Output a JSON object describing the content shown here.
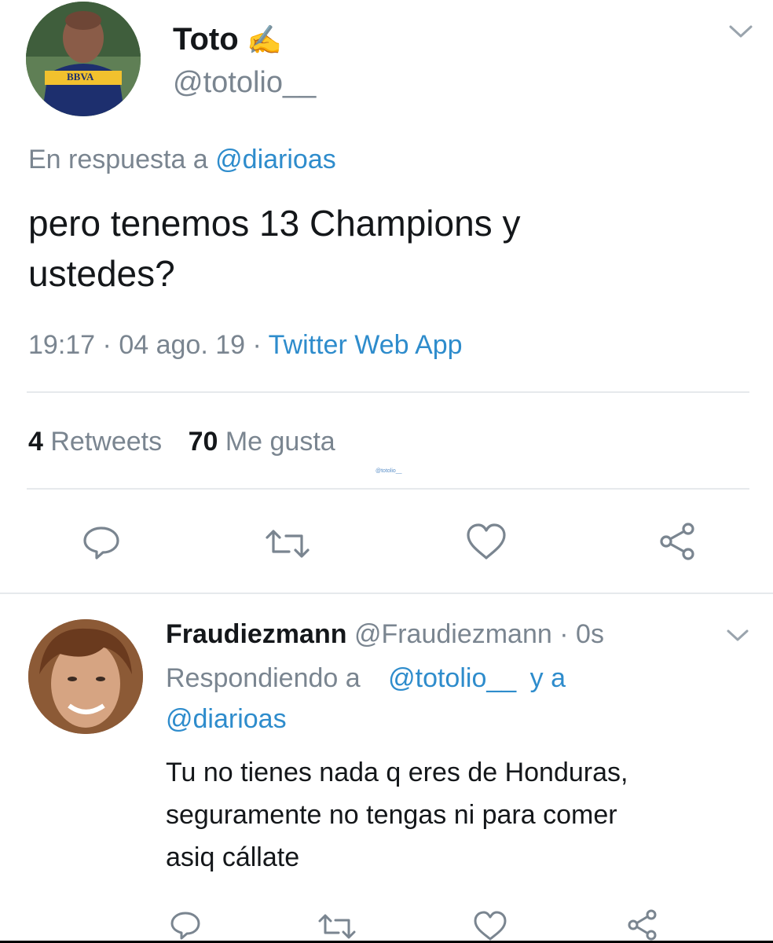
{
  "tweet": {
    "display_name": "Toto",
    "name_emoji": "✍",
    "handle": "@totolio__",
    "reply_prefix": "En respuesta a ",
    "reply_to": "@diarioas",
    "text_line1": "pero tenemos 13 Champions y",
    "text_line2": "ustedes?",
    "time": "19:17",
    "sep": "·",
    "date": "04 ago. 19",
    "source": "Twitter Web App",
    "retweets_count": "4",
    "retweets_label": "Retweets",
    "likes_count": "70",
    "likes_label": "Me gusta",
    "watermark": "@totolio__",
    "avatar_jersey_text": "BBVA",
    "menu_icon": "chevron-down-icon",
    "action_icons": [
      "reply-icon",
      "retweet-icon",
      "like-icon",
      "share-icon"
    ]
  },
  "reply": {
    "display_name": "Fraudiezmann",
    "handle": "@Fraudiezmann",
    "sep": "·",
    "time_ago": "0s",
    "replying_prefix": "Respondiendo a",
    "replying_user1": "@totolio__",
    "replying_and": "y a",
    "replying_user2": "@diarioas",
    "text_line1": "Tu no tienes nada q eres de Honduras,",
    "text_line2": "seguramente no tengas ni para comer",
    "text_line3": "asiq cállate"
  },
  "colors": {
    "link": "#2e8ccc",
    "muted": "#7a8590",
    "text": "#14171a",
    "jersey_blue": "#1d2f6e",
    "jersey_gold": "#f2c12e"
  }
}
